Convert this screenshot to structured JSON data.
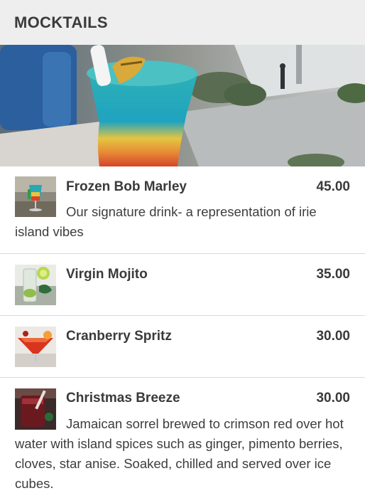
{
  "header": {
    "title": "MOCKTAILS"
  },
  "banner": {
    "image_name": "frozen-drink-photo"
  },
  "items": [
    {
      "name": "Frozen Bob Marley",
      "price": "45.00",
      "description": "Our signature drink- a representation of irie island vibes"
    },
    {
      "name": "Virgin Mojito",
      "price": "35.00"
    },
    {
      "name": "Cranberry Spritz",
      "price": "30.00"
    },
    {
      "name": "Christmas Breeze",
      "price": "30.00",
      "description": "Jamaican sorrel brewed to crimson red over hot water with island spices such as ginger, pimento berries, cloves, star anise. Soaked, chilled and served over ice cubes."
    }
  ]
}
